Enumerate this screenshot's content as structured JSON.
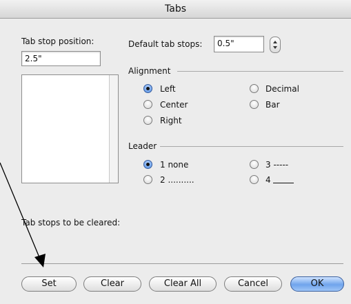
{
  "window": {
    "title": "Tabs"
  },
  "tab_stop": {
    "label": "Tab stop position:",
    "value": "2.5\""
  },
  "default_tabs": {
    "label": "Default tab stops:",
    "value": "0.5\""
  },
  "alignment": {
    "label": "Alignment",
    "options": [
      "Left",
      "Center",
      "Right",
      "Decimal",
      "Bar"
    ],
    "selected": "Left"
  },
  "leader": {
    "label": "Leader",
    "options": [
      "1 none",
      "2 ..........",
      "3 -----",
      "4"
    ],
    "selected": "1 none"
  },
  "clear_label": "Tab stops to be cleared:",
  "buttons": {
    "set": "Set",
    "clear": "Clear",
    "clear_all": "Clear All",
    "cancel": "Cancel",
    "ok": "OK"
  }
}
